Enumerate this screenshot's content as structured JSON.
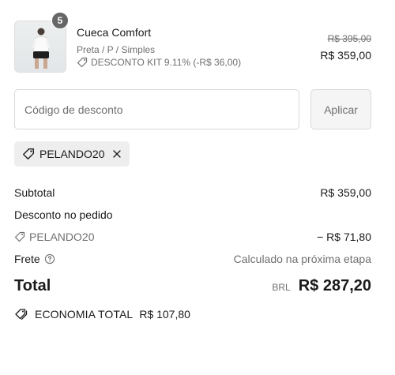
{
  "product": {
    "quantity": "5",
    "name": "Cueca Comfort",
    "variant": "Preta / P / Simples",
    "kit_discount": "DESCONTO KIT 9.11% (-R$ 36,00)",
    "original_price": "R$ 395,00",
    "price": "R$ 359,00",
    "icon": "tag-icon"
  },
  "discount_form": {
    "placeholder": "Código de desconto",
    "value": "",
    "apply_label": "Aplicar"
  },
  "applied_code": {
    "code": "PELANDO20",
    "icon": "tag-icon",
    "remove_icon": "close-icon"
  },
  "summary": {
    "subtotal_label": "Subtotal",
    "subtotal_value": "R$ 359,00",
    "order_discount_label": "Desconto no pedido",
    "discount_code": "PELANDO20",
    "discount_value": "− R$ 71,80",
    "shipping_label": "Frete",
    "shipping_value": "Calculado na próxima etapa",
    "shipping_info_icon": "help-circle-icon",
    "total_label": "Total",
    "currency": "BRL",
    "total_value": "R$ 287,20"
  },
  "savings": {
    "icon": "tags-icon",
    "label": "ECONOMIA TOTAL",
    "value": "R$ 107,80"
  },
  "colors": {
    "text": "#1a1a1a",
    "muted": "#707070",
    "border": "#d9d9d9",
    "chip_bg": "#eeeeee",
    "badge": "#666666"
  }
}
